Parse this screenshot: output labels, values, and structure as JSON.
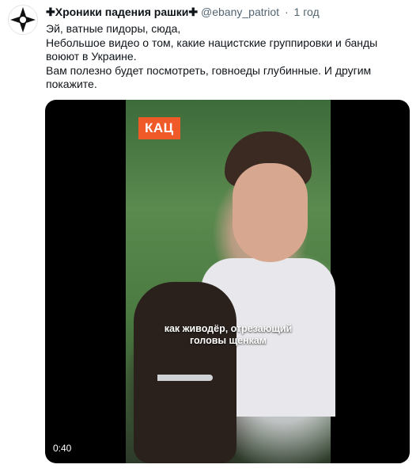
{
  "tweet": {
    "display_name": "✚Хроники падения рашки✚",
    "handle": "@ebany_patriot",
    "separator": "·",
    "time": "1 год",
    "text_lines": [
      "Эй, ватные пидоры, сюда,",
      "Небольшое видео о том, какие нацистские группировки и банды воюют в Украине.",
      "Вам полезно будет посмотреть, говноеды глубинные. И другим покажите."
    ]
  },
  "video": {
    "badge": "КАЦ",
    "caption_line1": "как живодёр, отрезающий",
    "caption_line2": "головы щенкам",
    "duration": "0:40"
  },
  "colors": {
    "badge_bg": "#f05a28",
    "text_primary": "#0f1419",
    "text_secondary": "#536471"
  },
  "icons": {
    "avatar": "black-white-cross-logo"
  }
}
